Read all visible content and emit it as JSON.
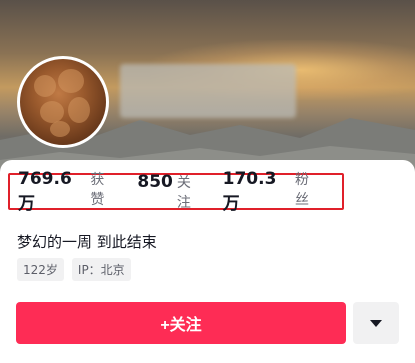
{
  "profile": {
    "stats": [
      {
        "value": "769.6万",
        "label": "获赞"
      },
      {
        "value": "850",
        "label": "关注"
      },
      {
        "value": "170.3万",
        "label": "粉丝"
      }
    ],
    "bio": "梦幻的一周 到此结束",
    "tags": [
      "122岁",
      "IP：北京"
    ]
  },
  "actions": {
    "follow_label": "+关注",
    "more_icon": "chevron-down-icon"
  },
  "colors": {
    "accent": "#fe2c55",
    "highlight_border": "#e0202a"
  }
}
